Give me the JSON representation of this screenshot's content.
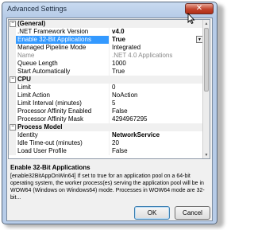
{
  "window": {
    "title": "Advanced Settings",
    "close_glyph": "✕"
  },
  "grid": {
    "rows": [
      {
        "type": "category",
        "toggle": "−",
        "name": "(General)"
      },
      {
        "type": "prop",
        "name": ".NET Framework Version",
        "value": "v4.0",
        "bold": true
      },
      {
        "type": "prop",
        "name": "Enable 32-Bit Applications",
        "value": "True",
        "bold": true,
        "selected": true,
        "dropdown": true
      },
      {
        "type": "prop",
        "name": "Managed Pipeline Mode",
        "value": "Integrated"
      },
      {
        "type": "prop",
        "name": "Name",
        "value": ".NET 4.0 Applications",
        "disabled": true
      },
      {
        "type": "prop",
        "name": "Queue Length",
        "value": "1000"
      },
      {
        "type": "prop",
        "name": "Start Automatically",
        "value": "True"
      },
      {
        "type": "category",
        "toggle": "−",
        "name": "CPU"
      },
      {
        "type": "prop",
        "name": "Limit",
        "value": "0"
      },
      {
        "type": "prop",
        "name": "Limit Action",
        "value": "NoAction"
      },
      {
        "type": "prop",
        "name": "Limit Interval (minutes)",
        "value": "5"
      },
      {
        "type": "prop",
        "name": "Processor Affinity Enabled",
        "value": "False"
      },
      {
        "type": "prop",
        "name": "Processor Affinity Mask",
        "value": "4294967295"
      },
      {
        "type": "category",
        "toggle": "−",
        "name": "Process Model"
      },
      {
        "type": "prop",
        "name": "Identity",
        "value": "NetworkService",
        "bold": true
      },
      {
        "type": "prop",
        "name": "Idle Time-out (minutes)",
        "value": "20"
      },
      {
        "type": "prop",
        "name": "Load User Profile",
        "value": "False"
      }
    ],
    "scroll_up": "▲",
    "scroll_down": "▼",
    "dropdown_glyph": "▼"
  },
  "description": {
    "title": "Enable 32-Bit Applications",
    "text": "[enable32BitAppOnWin64] If set to true for an application pool on a 64-bit operating system, the worker process(es) serving the application pool will be in WOW64 (Windows on Windows64) mode. Processes in WOW64 mode are 32-bit..."
  },
  "buttons": {
    "ok": "OK",
    "cancel": "Cancel"
  }
}
